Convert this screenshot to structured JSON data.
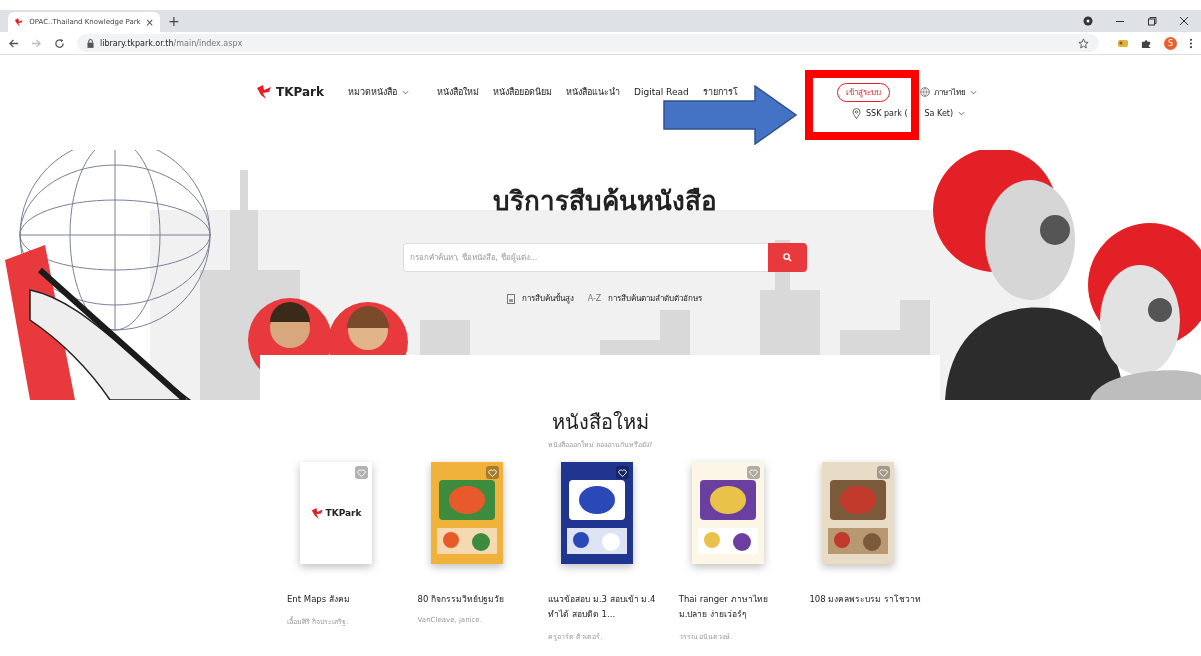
{
  "browser": {
    "tab_title": "OPAC..Thailand Knowledge Park",
    "tab_close": "×",
    "new_tab": "+",
    "url_domain": "library.tkpark.or.th",
    "url_path": "/main/index.aspx",
    "profile_initial": "S"
  },
  "nav": {
    "logo": "TKPark",
    "items": [
      {
        "label": "หมวดหนังสือ",
        "dropdown": true
      },
      {
        "label": "หนังสือใหม่",
        "dropdown": false
      },
      {
        "label": "หนังสือยอดนิยม",
        "dropdown": false
      },
      {
        "label": "หนังสือแนะนำ",
        "dropdown": false
      },
      {
        "label": "Digital Read",
        "dropdown": false
      },
      {
        "label": "รายการโ",
        "dropdown": false
      }
    ],
    "login": "เข้าสู่ระบบ",
    "language": "ภาษาไทย",
    "location": [
      "SSK park (",
      "Sa Ket)"
    ]
  },
  "hero": {
    "title": "บริการสืบค้นหนังสือ",
    "search": {
      "placeholder": "กรอกคำค้นหา, ชื่อหนังสือ, ชื่อผู้แต่ง..."
    },
    "links": [
      {
        "kind": "icon",
        "label": "การสืบค้นขั้นสูง"
      },
      {
        "kind": "badge",
        "badge": "A-Z",
        "label": "การสืบค้นตามลำดับตัวอักษร"
      }
    ]
  },
  "new_books": {
    "title": "หนังสือใหม่",
    "subtitle": "หนังสือออกใหม่ ลองอ่านกันหรือยัง?",
    "books": [
      {
        "logo_text": "TKPark",
        "title": "Ent Maps สังคม",
        "author": "เอื้อมศิริ กิจประเสริฐ."
      },
      {
        "title": "80 กิจกรรมวิทย์ปฐมวัย",
        "author": "VanCleave, janice."
      },
      {
        "title": "แนวข้อสอบ ม.3 สอบเข้า ม.4 ทำได้ สอบติด 1...",
        "author": "ครูอาร์ต ติวเตอร์."
      },
      {
        "title": "Thai ranger ภาษาไทย ม.ปลาย ง่ายเว่อร์ๆ",
        "author": "วรรณ อนันตวงษ์."
      },
      {
        "title": "108 มงคลพระบรม ราโชวาท"
      }
    ]
  }
}
